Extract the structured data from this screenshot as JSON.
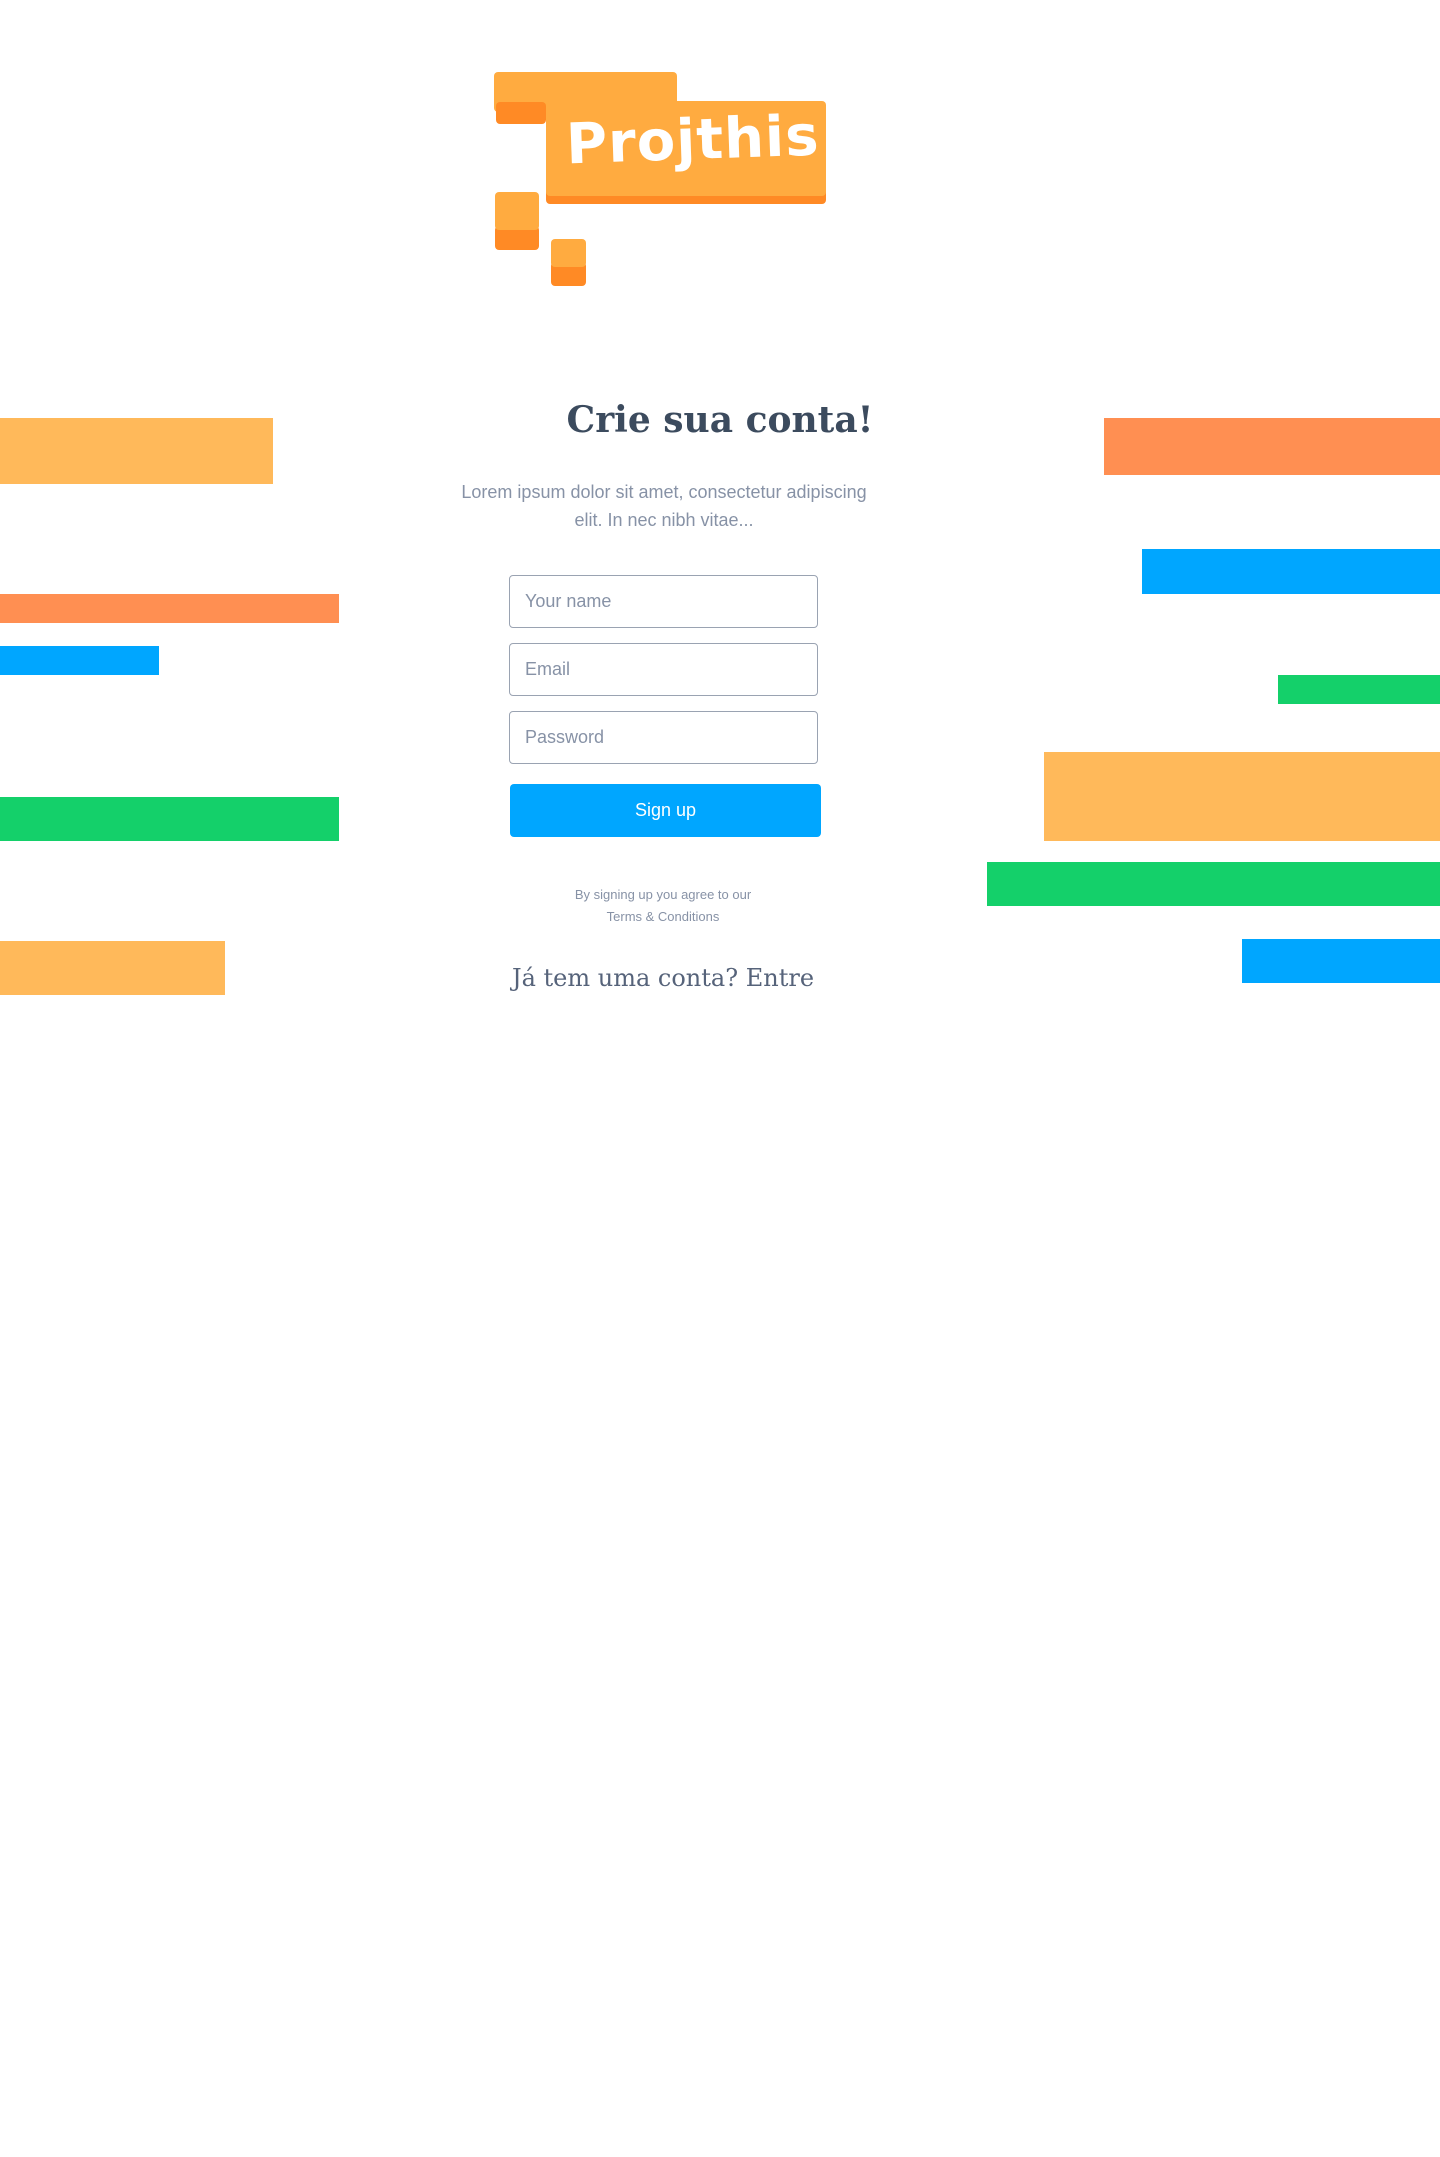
{
  "logo": {
    "text": "Projthis!"
  },
  "signup": {
    "title": "Crie sua conta!",
    "subtitle": "Lorem ipsum dolor sit amet, consectetur adipiscing elit. In nec nibh vitae...",
    "name_placeholder": "Your name",
    "email_placeholder": "Email",
    "password_placeholder": "Password",
    "button_label": "Sign up",
    "terms_prefix": "By signing up you agree to our",
    "terms_link": "Terms & Conditions",
    "login_prompt": "Já tem uma conta?",
    "login_link": "Entre"
  },
  "colors": {
    "accent": "#00a6ff",
    "orange_light": "#ffb95a",
    "orange_dark": "#ff8f52",
    "green": "#14d06a",
    "heading": "#3c4b5e"
  }
}
